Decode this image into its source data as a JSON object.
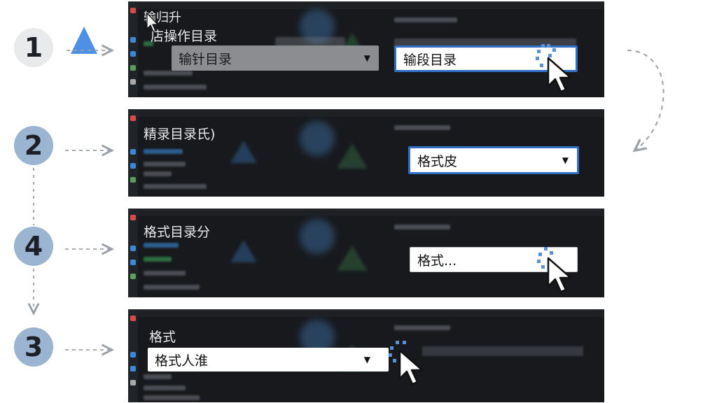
{
  "steps": [
    {
      "number": "1",
      "title_lines": [
        "输归升",
        "店操作目录"
      ],
      "field_left_value": "输针目录",
      "field_right_value": "输段目录"
    },
    {
      "number": "2",
      "title": "精录目录氏)",
      "field_value": "格式皮"
    },
    {
      "number": "4",
      "title": "格式目录分",
      "field_value": "格式..."
    },
    {
      "number": "3",
      "title": "格式",
      "field_value": "格式人淮"
    }
  ],
  "colors": {
    "accent_blue": "#2f6fc7",
    "badge_blue": "#9ab4d2",
    "badge_gray": "#e9eaec",
    "panel_bg": "#17191d",
    "triangle_blue": "#4d90e6",
    "connector_gray": "#9aa0a8"
  },
  "icons": {
    "step1_marker": "triangle-icon",
    "pointer": "mouse-pointer-icon",
    "dropdown": "chevron-down-icon"
  }
}
